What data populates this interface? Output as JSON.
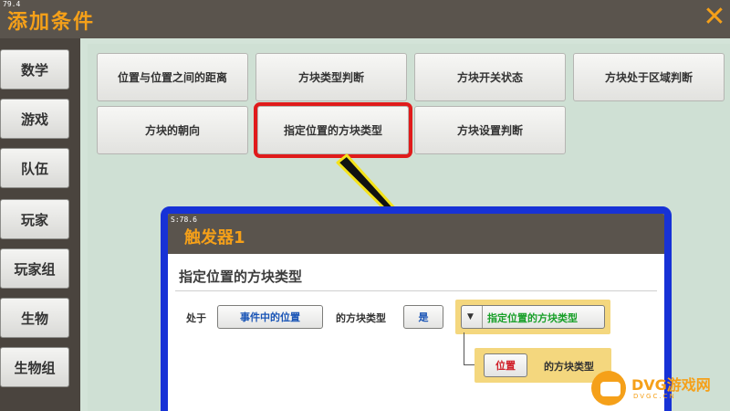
{
  "window": {
    "fps": "79.4",
    "title": "添加条件",
    "close_glyph": "✕"
  },
  "sidebar": {
    "items": [
      {
        "label": "数学"
      },
      {
        "label": "游戏"
      },
      {
        "label": "队伍"
      },
      {
        "label": "玩家"
      },
      {
        "label": "玩家组"
      },
      {
        "label": "生物"
      },
      {
        "label": "生物组"
      }
    ]
  },
  "conditions": [
    {
      "label": "位置与位置之间的距离"
    },
    {
      "label": "方块类型判断"
    },
    {
      "label": "方块开关状态"
    },
    {
      "label": "方块处于区域判断"
    },
    {
      "label": "方块的朝向"
    },
    {
      "label": "指定位置的方块类型",
      "selected": true
    },
    {
      "label": "方块设置判断"
    }
  ],
  "popup": {
    "fps": "S:78.6",
    "title": "触发器1",
    "subtitle": "指定位置的方块类型",
    "row": {
      "prefix": "处于",
      "position_chip": "事件中的位置",
      "middle": "的方块类型",
      "is_chip": "是",
      "dropdown_value": "指定位置的方块类型"
    },
    "sub": {
      "chip": "位置",
      "suffix": "的方块类型"
    }
  },
  "watermark": {
    "brand": "DVG游戏网",
    "url": "DVGC.CN"
  },
  "colors": {
    "accent_orange": "#f5a019",
    "highlight_red": "#e01b1b",
    "popup_border_blue": "#1732d6",
    "chip_blue_text": "#1a55b6",
    "chip_green_text": "#1aa02a",
    "arrow_yellow": "#f4e21a"
  }
}
